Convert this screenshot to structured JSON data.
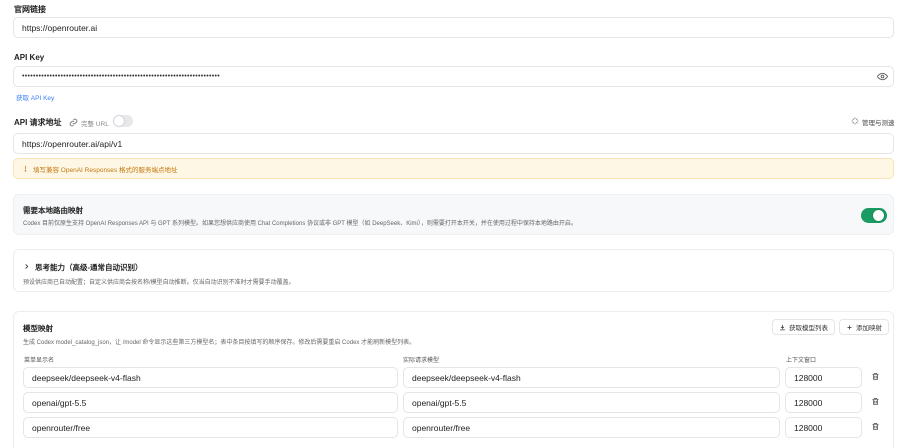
{
  "website": {
    "label": "官网链接",
    "value": "https://openrouter.ai"
  },
  "api_key": {
    "label": "API Key",
    "masked_value": "••••••••••••••••••••••••••••••••••••••••••••••••••••••••••••••••••••••••",
    "get_key_link": "获取 API Key"
  },
  "endpoint": {
    "label": "API 请求地址",
    "full_url_label": "完整 URL",
    "full_url_enabled": false,
    "manage_label": "管理与测速",
    "value": "https://openrouter.ai/api/v1",
    "warning": "填写兼容 OpenAI Responses 格式的服务端点地址"
  },
  "local_routing": {
    "title": "需要本地路由映射",
    "description": "Codex 目前仅原生支持 OpenAI Responses API 与 GPT 系列模型。如果您想供应商使用 Chat Completions 协议或非 GPT 模型（如 DeepSeek、Kimi），则需要打开本开关，并在使用过程中保持本地路由开启。",
    "enabled": true
  },
  "thinking": {
    "title": "思考能力（高级-通常自动识别）",
    "description": "预设供应商已自动配置；自定义供应商会按名称/模型自动推断。仅当自动识别不准时才需要手动覆盖。"
  },
  "model_mapping": {
    "title": "模型映射",
    "description": "生成 Codex model_catalog_json，让 /model 命令显示这些第三方模型名；表中条目按填写的顺序保存。修改后需要重启 Codex 才能刷新模型列表。",
    "fetch_button": "获取模型列表",
    "add_button": "添加映射",
    "columns": {
      "display_name": "菜单显示名",
      "actual_model": "实际请求模型",
      "context_window": "上下文窗口"
    },
    "rows": [
      {
        "display_name": "deepseek/deepseek-v4-flash",
        "actual_model": "deepseek/deepseek-v4-flash",
        "context_window": "128000"
      },
      {
        "display_name": "openai/gpt-5.5",
        "actual_model": "openai/gpt-5.5",
        "context_window": "128000"
      },
      {
        "display_name": "openrouter/free",
        "actual_model": "openrouter/free",
        "context_window": "128000"
      }
    ]
  },
  "colors": {
    "accent": "#1a9b63",
    "link": "#3b82f6",
    "warning_bg": "#fff7e6",
    "warning_text": "#c2790f"
  }
}
